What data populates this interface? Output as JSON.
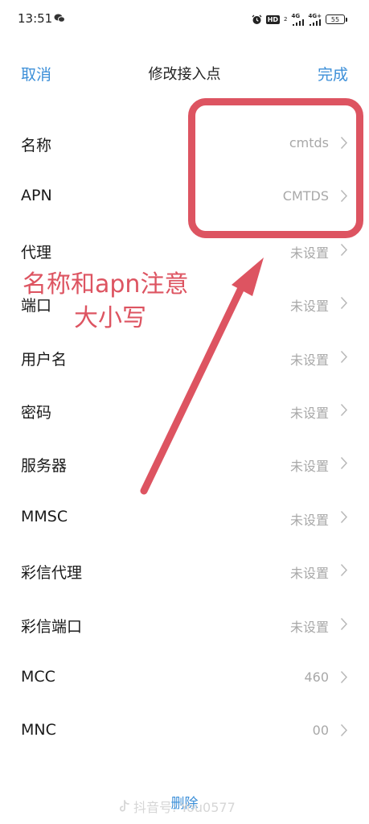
{
  "status_bar": {
    "time": "13:51",
    "hd_label": "HD",
    "sim_sub": "2",
    "net1": "4G",
    "net2": "4G+",
    "battery": "55"
  },
  "header": {
    "cancel_label": "取消",
    "title": "修改接入点",
    "done_label": "完成"
  },
  "settings": [
    {
      "label": "名称",
      "value": "cmtds"
    },
    {
      "label": "APN",
      "value": "CMTDS"
    },
    {
      "label": "代理",
      "value": "未设置"
    },
    {
      "label": "端口",
      "value": "未设置"
    },
    {
      "label": "用户名",
      "value": "未设置"
    },
    {
      "label": "密码",
      "value": "未设置"
    },
    {
      "label": "服务器",
      "value": "未设置"
    },
    {
      "label": "MMSC",
      "value": "未设置"
    },
    {
      "label": "彩信代理",
      "value": "未设置"
    },
    {
      "label": "彩信端口",
      "value": "未设置"
    },
    {
      "label": "MCC",
      "value": "460"
    },
    {
      "label": "MNC",
      "value": "00"
    }
  ],
  "delete_label": "删除",
  "annotation": {
    "line1": "名称和apn注意",
    "line2": "大小写",
    "color": "#dd5461"
  },
  "watermark": {
    "text": "抖音号: You0577"
  },
  "colors": {
    "accent": "#3c8fd8",
    "value_gray": "#a8a8a8"
  }
}
